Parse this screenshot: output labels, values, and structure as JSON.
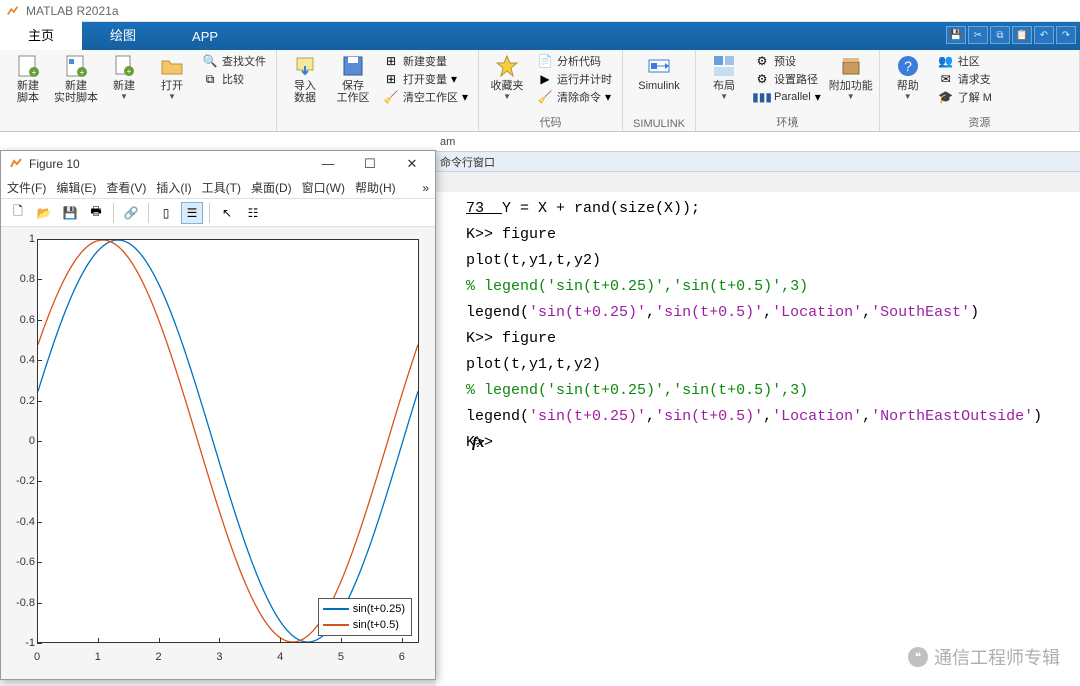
{
  "app_title": "MATLAB R2021a",
  "tabs": {
    "home": "主页",
    "plots": "绘图",
    "apps": "APP"
  },
  "toolstrip": {
    "new_script": "新建\n脚本",
    "new_live": "新建\n实时脚本",
    "new": "新建",
    "open": "打开",
    "find_files": "查找文件",
    "compare": "比较",
    "import": "导入\n数据",
    "save_ws": "保存\n工作区",
    "new_var": "新建变量",
    "open_var": "打开变量",
    "clear_ws": "清空工作区",
    "favorites": "收藏夹",
    "analyze": "分析代码",
    "run_time": "运行并计时",
    "clear_cmd": "清除命令",
    "simulink": "Simulink",
    "layout": "布局",
    "prefs": "预设",
    "set_path": "设置路径",
    "parallel": "Parallel",
    "addons": "附加功能",
    "help": "帮助",
    "community": "社区",
    "request": "请求支",
    "learn": "了解 M",
    "sec_code": "代码",
    "sec_simulink": "SIMULINK",
    "sec_env": "环境",
    "sec_res": "资源"
  },
  "pathbar_text": "am",
  "cmdwin_title": "命令行窗口",
  "cmd": {
    "l1a": "73  ",
    "l1b": "Y = X + rand(size(X));",
    "l2": "K>> figure",
    "l3": "plot(t,y1,t,y2)",
    "l4a": "% legend(",
    "l4b": "'sin(t+0.25)'",
    "l4c": ",",
    "l4d": "'sin(t+0.5)'",
    "l4e": ",3)",
    "l5a": "legend(",
    "l5b": "'sin(t+0.25)'",
    "l5c": ",",
    "l5d": "'sin(t+0.5)'",
    "l5e": ",",
    "l5f": "'Location'",
    "l5g": ",",
    "l5h": "'SouthEast'",
    "l5i": ")",
    "l6": "K>> figure",
    "l7": "plot(t,y1,t,y2)",
    "l8a": "% legend(",
    "l8b": "'sin(t+0.25)'",
    "l8c": ",",
    "l8d": "'sin(t+0.5)'",
    "l8e": ",3)",
    "l9a": "legend(",
    "l9b": "'sin(t+0.25)'",
    "l9c": ",",
    "l9d": "'sin(t+0.5)'",
    "l9e": ",",
    "l9f": "'Location'",
    "l9g": ",",
    "l9h": "'NorthEastOutside'",
    "l9i": ")",
    "l10": "K>> ",
    "fx": "fx"
  },
  "figure": {
    "title": "Figure 10",
    "menus": [
      "文件(F)",
      "编辑(E)",
      "查看(V)",
      "插入(I)",
      "工具(T)",
      "桌面(D)",
      "窗口(W)",
      "帮助(H)"
    ],
    "legend": {
      "s1": "sin(t+0.25)",
      "s2": "sin(t+0.5)"
    }
  },
  "watermark": "通信工程师专辑",
  "chart_data": {
    "type": "line",
    "title": "",
    "xlabel": "",
    "ylabel": "",
    "xlim": [
      0,
      6.2832
    ],
    "ylim": [
      -1,
      1
    ],
    "xticks": [
      0,
      1,
      2,
      3,
      4,
      5,
      6
    ],
    "yticks": [
      -1,
      -0.8,
      -0.6,
      -0.4,
      -0.2,
      0,
      0.2,
      0.4,
      0.6,
      0.8,
      1
    ],
    "legend_position": "southeast",
    "series": [
      {
        "name": "sin(t+0.25)",
        "color": "#0072bd",
        "formula": "sin(x+0.25)"
      },
      {
        "name": "sin(t+0.5)",
        "color": "#d95319",
        "formula": "sin(x+0.5)"
      }
    ]
  }
}
